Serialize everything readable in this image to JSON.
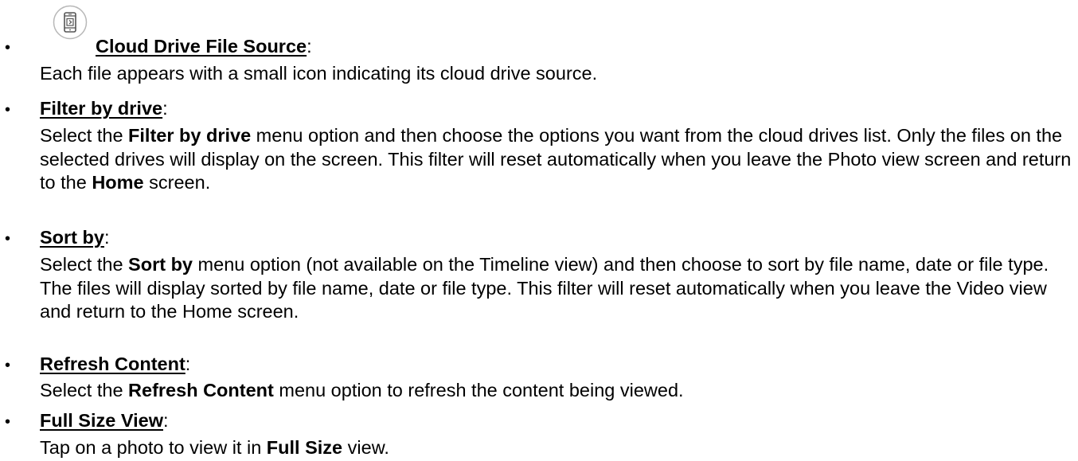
{
  "items": [
    {
      "heading": "Cloud Drive File Source",
      "icon": "smartphone-icon",
      "desc": [
        {
          "t": "Each file appears with a small icon indicating its cloud drive source."
        }
      ]
    },
    {
      "heading": "Filter by drive",
      "desc": [
        {
          "t": "Select the "
        },
        {
          "t": "Filter by drive",
          "b": true
        },
        {
          "t": " menu option and then choose the options you want from the cloud drives list. Only the files on the selected drives will display on the screen. This filter will reset automatically when you leave the Photo view screen and return to the "
        },
        {
          "t": "Home",
          "b": true
        },
        {
          "t": " screen."
        }
      ]
    },
    {
      "heading": "Sort by",
      "desc": [
        {
          "t": "Select the "
        },
        {
          "t": "Sort by",
          "b": true
        },
        {
          "t": " menu option (not available on the Timeline view) and then choose to sort by file name, date or file type. The files will display sorted by file name, date or file type. This filter will reset automatically when you leave the Video view and return to the Home screen."
        }
      ]
    },
    {
      "heading": "Refresh Content",
      "desc": [
        {
          "t": "Select the "
        },
        {
          "t": "Refresh Content",
          "b": true
        },
        {
          "t": " menu option to refresh the content being viewed."
        }
      ]
    },
    {
      "heading": "Full Size View",
      "desc": [
        {
          "t": "Tap on a photo to view it in "
        },
        {
          "t": "Full Size",
          "b": true
        },
        {
          "t": " view."
        }
      ]
    }
  ]
}
